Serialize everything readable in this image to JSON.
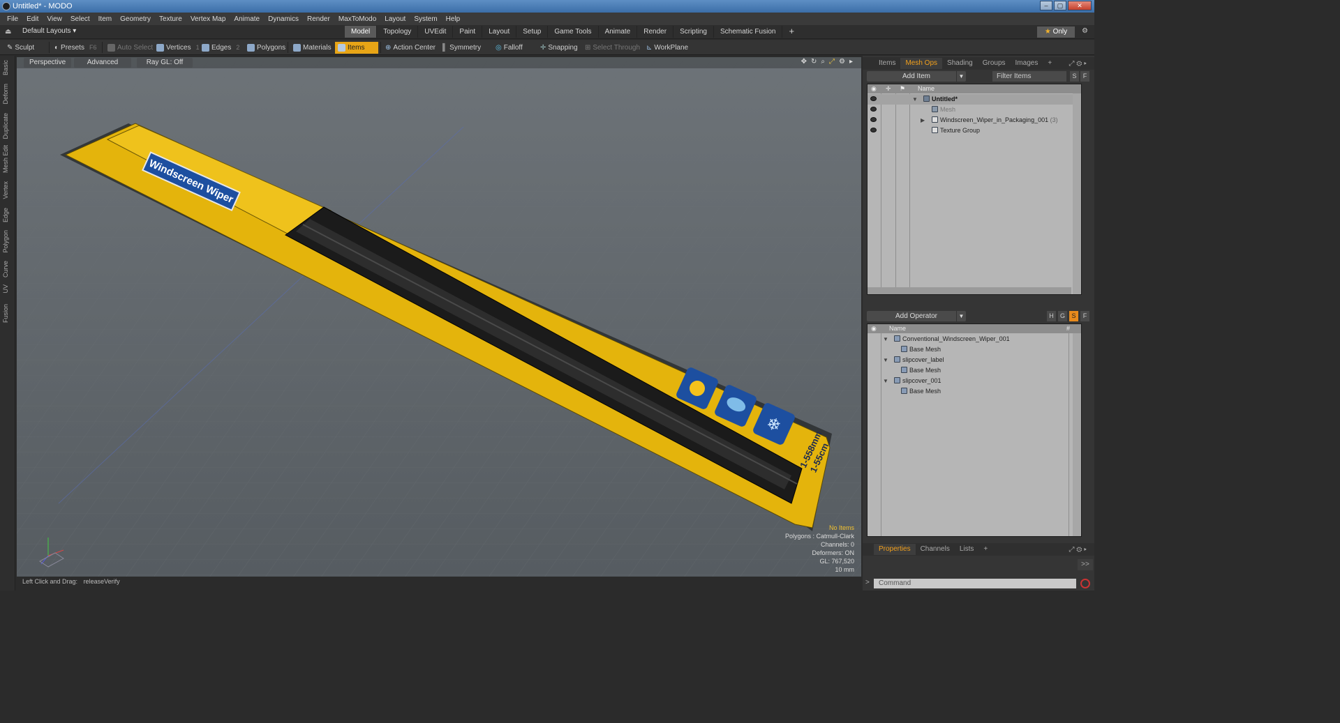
{
  "window": {
    "title": "Untitled* - MODO",
    "controls": [
      "–",
      "▢",
      "✕"
    ]
  },
  "menu": [
    "File",
    "Edit",
    "View",
    "Select",
    "Item",
    "Geometry",
    "Texture",
    "Vertex Map",
    "Animate",
    "Dynamics",
    "Render",
    "MaxToModo",
    "Layout",
    "System",
    "Help"
  ],
  "layoutbar": {
    "layouts_label": "Default Layouts ▾",
    "tabs": [
      "Model",
      "Topology",
      "UVEdit",
      "Paint",
      "Layout",
      "Setup",
      "Game Tools",
      "Animate",
      "Render",
      "Scripting",
      "Schematic Fusion"
    ],
    "active_tab": "Model",
    "add_tab": "+",
    "only_label": "Only",
    "only_star": "★"
  },
  "toolbar": {
    "sculpt": "Sculpt",
    "presets": "Presets",
    "presets_key": "F6",
    "auto_select": "Auto Select",
    "vertices": "Vertices",
    "vertices_key": "1",
    "edges": "Edges",
    "edges_key": "2",
    "polygons": "Polygons",
    "materials": "Materials",
    "items": "Items",
    "action_center": "Action Center",
    "symmetry": "Symmetry",
    "falloff": "Falloff",
    "snapping": "Snapping",
    "select_through": "Select Through",
    "workplane": "WorkPlane"
  },
  "left_tabs": [
    "Basic",
    "Deform",
    "Duplicate",
    "Mesh Edit",
    "Vertex",
    "Edge",
    "Polygon",
    "Curve",
    "UV",
    "Fusion"
  ],
  "viewport": {
    "view_mode": "Perspective",
    "advanced": "Advanced",
    "raygl": "Ray GL: Off",
    "info": {
      "selection": "No Items",
      "polygons": "Polygons : Catmull-Clark",
      "channels": "Channels: 0",
      "deformers": "Deformers: ON",
      "gl": "GL: 767,520",
      "unit": "10 mm"
    },
    "package": {
      "brand_text": "Windscreen Wiper",
      "size_mm": "1-558mm",
      "size_cm": "1-55cm",
      "colors": {
        "package": "#e8b80f",
        "blade": "#1c1c1c",
        "label": "#1d4fa0"
      }
    }
  },
  "status": {
    "hint_label": "Left Click and Drag:",
    "hint_value": "releaseVerify"
  },
  "items_panel": {
    "tabs": [
      "Items",
      "Mesh Ops",
      "Shading",
      "Groups",
      "Images",
      "+"
    ],
    "active_tab": "Mesh Ops",
    "add_item": "Add Item",
    "filter_placeholder": "Filter Items",
    "s_btn": "S",
    "f_btn": "F",
    "col_name": "Name",
    "rows": [
      {
        "label": "Untitled*",
        "count": ""
      },
      {
        "label": "Mesh",
        "count": ""
      },
      {
        "label": "Windscreen_Wiper_in_Packaging_001",
        "count": "(3)"
      },
      {
        "label": "Texture Group",
        "count": ""
      }
    ]
  },
  "meshops_panel": {
    "add_operator": "Add Operator",
    "buttons": [
      "H",
      "G",
      "S",
      "F"
    ],
    "col_name": "Name",
    "col_hash": "#",
    "rows": [
      {
        "label": "Conventional_Windscreen_Wiper_001",
        "level": 0
      },
      {
        "label": "Base Mesh",
        "level": 1
      },
      {
        "label": "slipcover_label",
        "level": 0
      },
      {
        "label": "Base Mesh",
        "level": 1
      },
      {
        "label": "slipcover_001",
        "level": 0
      },
      {
        "label": "Base Mesh",
        "level": 1
      }
    ]
  },
  "properties_panel": {
    "tabs": [
      "Properties",
      "Channels",
      "Lists",
      "+"
    ],
    "active_tab": "Properties",
    "expand": ">>",
    "command_placeholder": "Command",
    "command_prompt": ">"
  }
}
